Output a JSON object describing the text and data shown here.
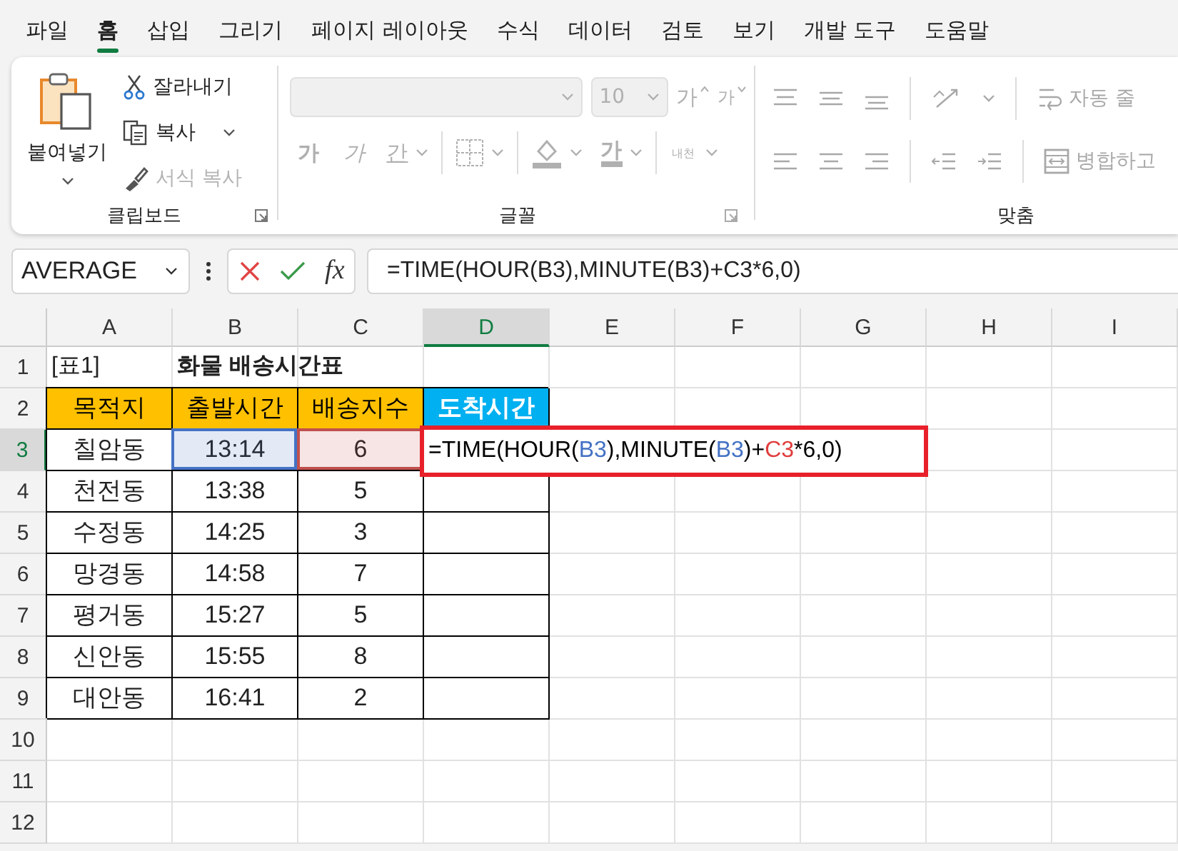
{
  "menu_tabs": [
    {
      "label": "파일",
      "selected": false
    },
    {
      "label": "홈",
      "selected": true
    },
    {
      "label": "삽입",
      "selected": false
    },
    {
      "label": "그리기",
      "selected": false
    },
    {
      "label": "페이지 레이아웃",
      "selected": false
    },
    {
      "label": "수식",
      "selected": false
    },
    {
      "label": "데이터",
      "selected": false
    },
    {
      "label": "검토",
      "selected": false
    },
    {
      "label": "보기",
      "selected": false
    },
    {
      "label": "개발 도구",
      "selected": false
    },
    {
      "label": "도움말",
      "selected": false
    }
  ],
  "ribbon": {
    "clipboard": {
      "label": "클립보드",
      "paste": "붙여넣기",
      "cut": "잘라내기",
      "copy": "복사",
      "format_painter": {
        "label": "서식 복사",
        "disabled": true
      }
    },
    "font": {
      "label": "글꼴",
      "size": "10",
      "grow": "가",
      "shrink": "가",
      "bold": "가",
      "italic": "가",
      "underline": "간",
      "font_color": "가",
      "phonetic": "내천",
      "disabled": true
    },
    "alignment": {
      "label": "맞춤",
      "wrap": "자동 줄",
      "merge": "병합하고",
      "disabled": true
    }
  },
  "formula_bar": {
    "name_box": "AVERAGE",
    "function_label": "fx",
    "formula": "=TIME(HOUR(B3),MINUTE(B3)+C3*6,0)"
  },
  "sheet": {
    "columns": [
      {
        "label": "A",
        "selected": false
      },
      {
        "label": "B",
        "selected": false
      },
      {
        "label": "C",
        "selected": false
      },
      {
        "label": "D",
        "selected": true
      },
      {
        "label": "E",
        "selected": false
      },
      {
        "label": "F",
        "selected": false
      },
      {
        "label": "G",
        "selected": false
      },
      {
        "label": "H",
        "selected": false
      },
      {
        "label": "I",
        "selected": false
      }
    ],
    "rows": [
      {
        "label": "1",
        "selected": false,
        "cells": [
          {
            "kind": "label",
            "text": "[표1]"
          },
          {
            "kind": "title",
            "text": "화물 배송시간표"
          }
        ]
      },
      {
        "label": "2",
        "selected": false,
        "cells": [
          {
            "kind": "header",
            "text": "목적지",
            "color": "#ffc000"
          },
          {
            "kind": "header",
            "text": "출발시간",
            "color": "#ffc000"
          },
          {
            "kind": "header",
            "text": "배송지수",
            "color": "#ffc000"
          },
          {
            "kind": "header",
            "text": "도착시간",
            "color": "#00b0f0"
          }
        ]
      },
      {
        "label": "3",
        "selected": true,
        "cells": [
          {
            "kind": "data",
            "text": "칠암동"
          },
          {
            "kind": "ref",
            "text": "13:14",
            "color": "#4472c4"
          },
          {
            "kind": "ref",
            "text": "6",
            "color": "#c0504d"
          },
          {
            "kind": "edit",
            "parts": [
              {
                "text": "=TIME(HOUR(",
                "color": "#000000"
              },
              {
                "text": "B3",
                "color": "#4472c4"
              },
              {
                "text": "),MINUTE(",
                "color": "#000000"
              },
              {
                "text": "B3",
                "color": "#4472c4"
              },
              {
                "text": ")+",
                "color": "#000000"
              },
              {
                "text": "C3",
                "color": "#e03c3c"
              },
              {
                "text": "*6,0)",
                "color": "#000000"
              }
            ]
          }
        ]
      },
      {
        "label": "4",
        "selected": false,
        "cells": [
          {
            "kind": "data",
            "text": "천전동"
          },
          {
            "kind": "data",
            "text": "13:38"
          },
          {
            "kind": "data",
            "text": "5"
          },
          {
            "kind": "data",
            "text": ""
          }
        ]
      },
      {
        "label": "5",
        "selected": false,
        "cells": [
          {
            "kind": "data",
            "text": "수정동"
          },
          {
            "kind": "data",
            "text": "14:25"
          },
          {
            "kind": "data",
            "text": "3"
          },
          {
            "kind": "data",
            "text": ""
          }
        ]
      },
      {
        "label": "6",
        "selected": false,
        "cells": [
          {
            "kind": "data",
            "text": "망경동"
          },
          {
            "kind": "data",
            "text": "14:58"
          },
          {
            "kind": "data",
            "text": "7"
          },
          {
            "kind": "data",
            "text": ""
          }
        ]
      },
      {
        "label": "7",
        "selected": false,
        "cells": [
          {
            "kind": "data",
            "text": "평거동"
          },
          {
            "kind": "data",
            "text": "15:27"
          },
          {
            "kind": "data",
            "text": "5"
          },
          {
            "kind": "data",
            "text": ""
          }
        ]
      },
      {
        "label": "8",
        "selected": false,
        "cells": [
          {
            "kind": "data",
            "text": "신안동"
          },
          {
            "kind": "data",
            "text": "15:55"
          },
          {
            "kind": "data",
            "text": "8"
          },
          {
            "kind": "data",
            "text": ""
          }
        ]
      },
      {
        "label": "9",
        "selected": false,
        "cells": [
          {
            "kind": "data",
            "text": "대안동"
          },
          {
            "kind": "data",
            "text": "16:41"
          },
          {
            "kind": "data",
            "text": "2"
          },
          {
            "kind": "data",
            "text": ""
          }
        ]
      },
      {
        "label": "10",
        "selected": false,
        "cells": []
      },
      {
        "label": "11",
        "selected": false,
        "cells": []
      },
      {
        "label": "12",
        "selected": false,
        "cells": []
      }
    ]
  }
}
